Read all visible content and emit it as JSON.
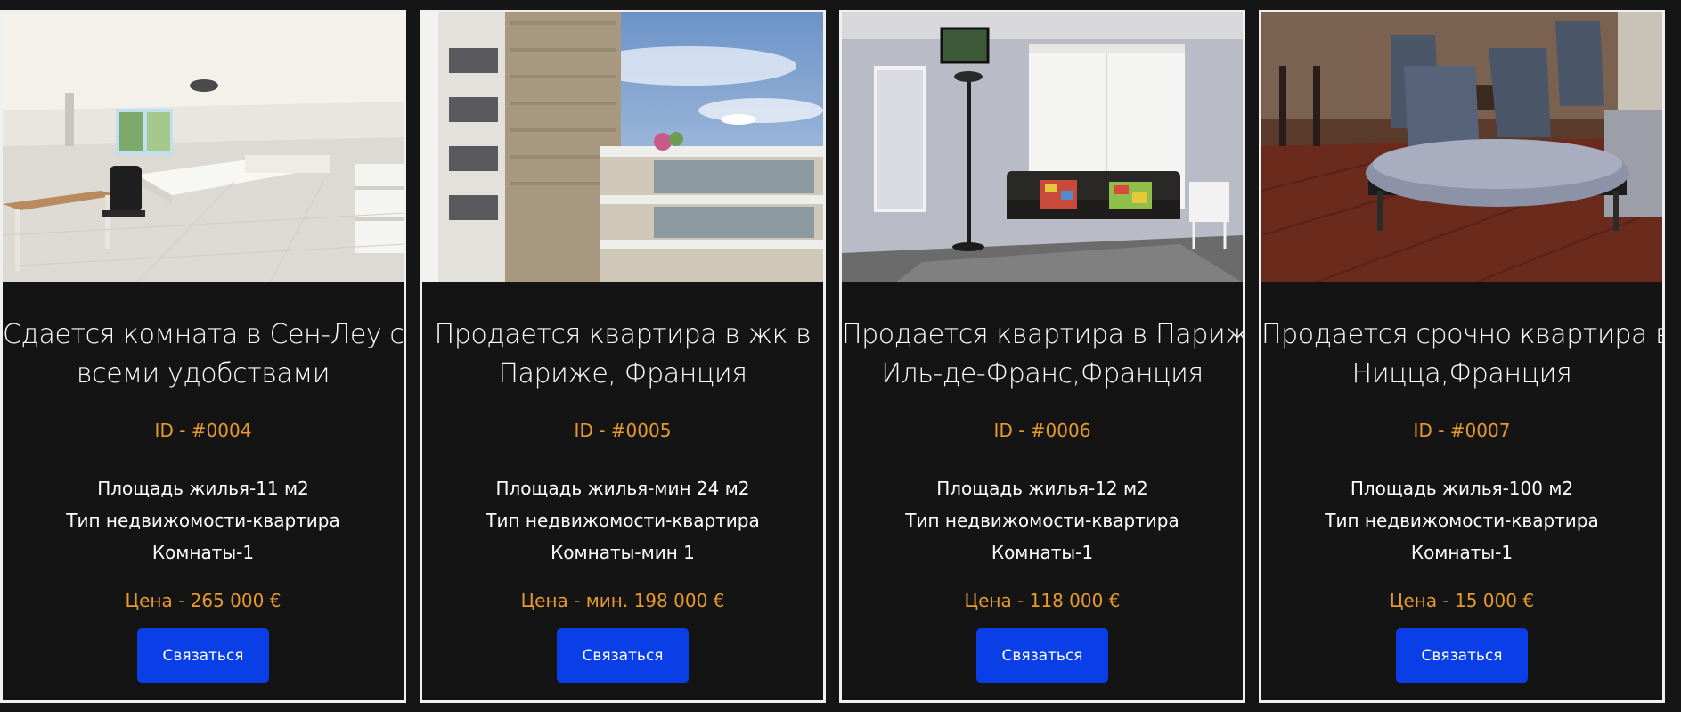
{
  "listings": [
    {
      "image": "bright-room-with-desk-and-bed",
      "title_line1": "Сдается комната в Сен-Леу со",
      "title_line2": "всеми удобствами",
      "id": "ID - #0004",
      "area": "Площадь жилья-11 м2",
      "type": "Тип недвижомости-квартира",
      "rooms": "Комнаты-1",
      "price": "Цена - 265 000 €",
      "button": "Связаться"
    },
    {
      "image": "modern-apartment-building-exterior",
      "title_line1": "Продается квартира в жк в",
      "title_line2": "Париже, Франция",
      "id": "ID - #0005",
      "area": "Площадь жилья-мин 24 м2",
      "type": "Тип недвижомости-квартира",
      "rooms": "Комнаты-мин 1",
      "price": "Цена - мин. 198 000 €",
      "button": "Связаться"
    },
    {
      "image": "studio-with-sofa-and-murphy-bed",
      "title_line1": "Продается квартира в Париже",
      "title_line2": "Иль-де-Франс,Франция",
      "id": "ID - #0006",
      "area": "Площадь жилья-12 м2",
      "type": "Тип недвижомости-квартира",
      "rooms": "Комнаты-1",
      "price": "Цена - 118 000 €",
      "button": "Связаться"
    },
    {
      "image": "dining-area-with-bench-and-chairs",
      "title_line1": "Продается срочно квартира в",
      "title_line2": "Ницца,Франция",
      "id": "ID - #0007",
      "area": "Площадь жилья-100 м2",
      "type": "Тип недвижомости-квартира",
      "rooms": "Комнаты-1",
      "price": "Цена - 15 000 €",
      "button": "Связаться"
    }
  ],
  "colors": {
    "background": "#151515",
    "card_border": "#f0f0f0",
    "accent_orange": "#e79a2c",
    "button_blue": "#0a3fe8",
    "text": "#ffffff"
  }
}
